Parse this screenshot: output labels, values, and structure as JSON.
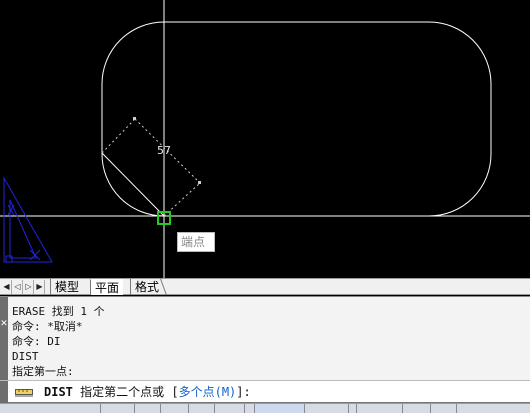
{
  "drawing": {
    "dimension_value": "57",
    "osnap_tooltip": "端点",
    "colors": {
      "background": "#000000",
      "geometry": "#ffffff",
      "crosshair": "#ffffff",
      "osnap_marker": "#22cc22",
      "ucs_icon": "#2222dd"
    }
  },
  "layout_tabs": {
    "nav_buttons": [
      "◀",
      "◁",
      "▷",
      "▶"
    ],
    "tabs": [
      "模型",
      "平面",
      "格式"
    ],
    "active": "平面"
  },
  "command_history": [
    "ERASE 找到 1 个",
    "命令: *取消*",
    "命令: DI",
    "DIST",
    "指定第一点:"
  ],
  "command_line": {
    "icon": "ruler-icon",
    "command": "DIST",
    "prompt": " 指定第二个点或 [",
    "option": "多个点(M)",
    "suffix": "]:"
  },
  "status_bar": {
    "items": [
      "",
      "",
      "",
      "",
      "",
      "",
      "",
      "",
      "",
      "",
      "",
      "",
      ""
    ]
  }
}
